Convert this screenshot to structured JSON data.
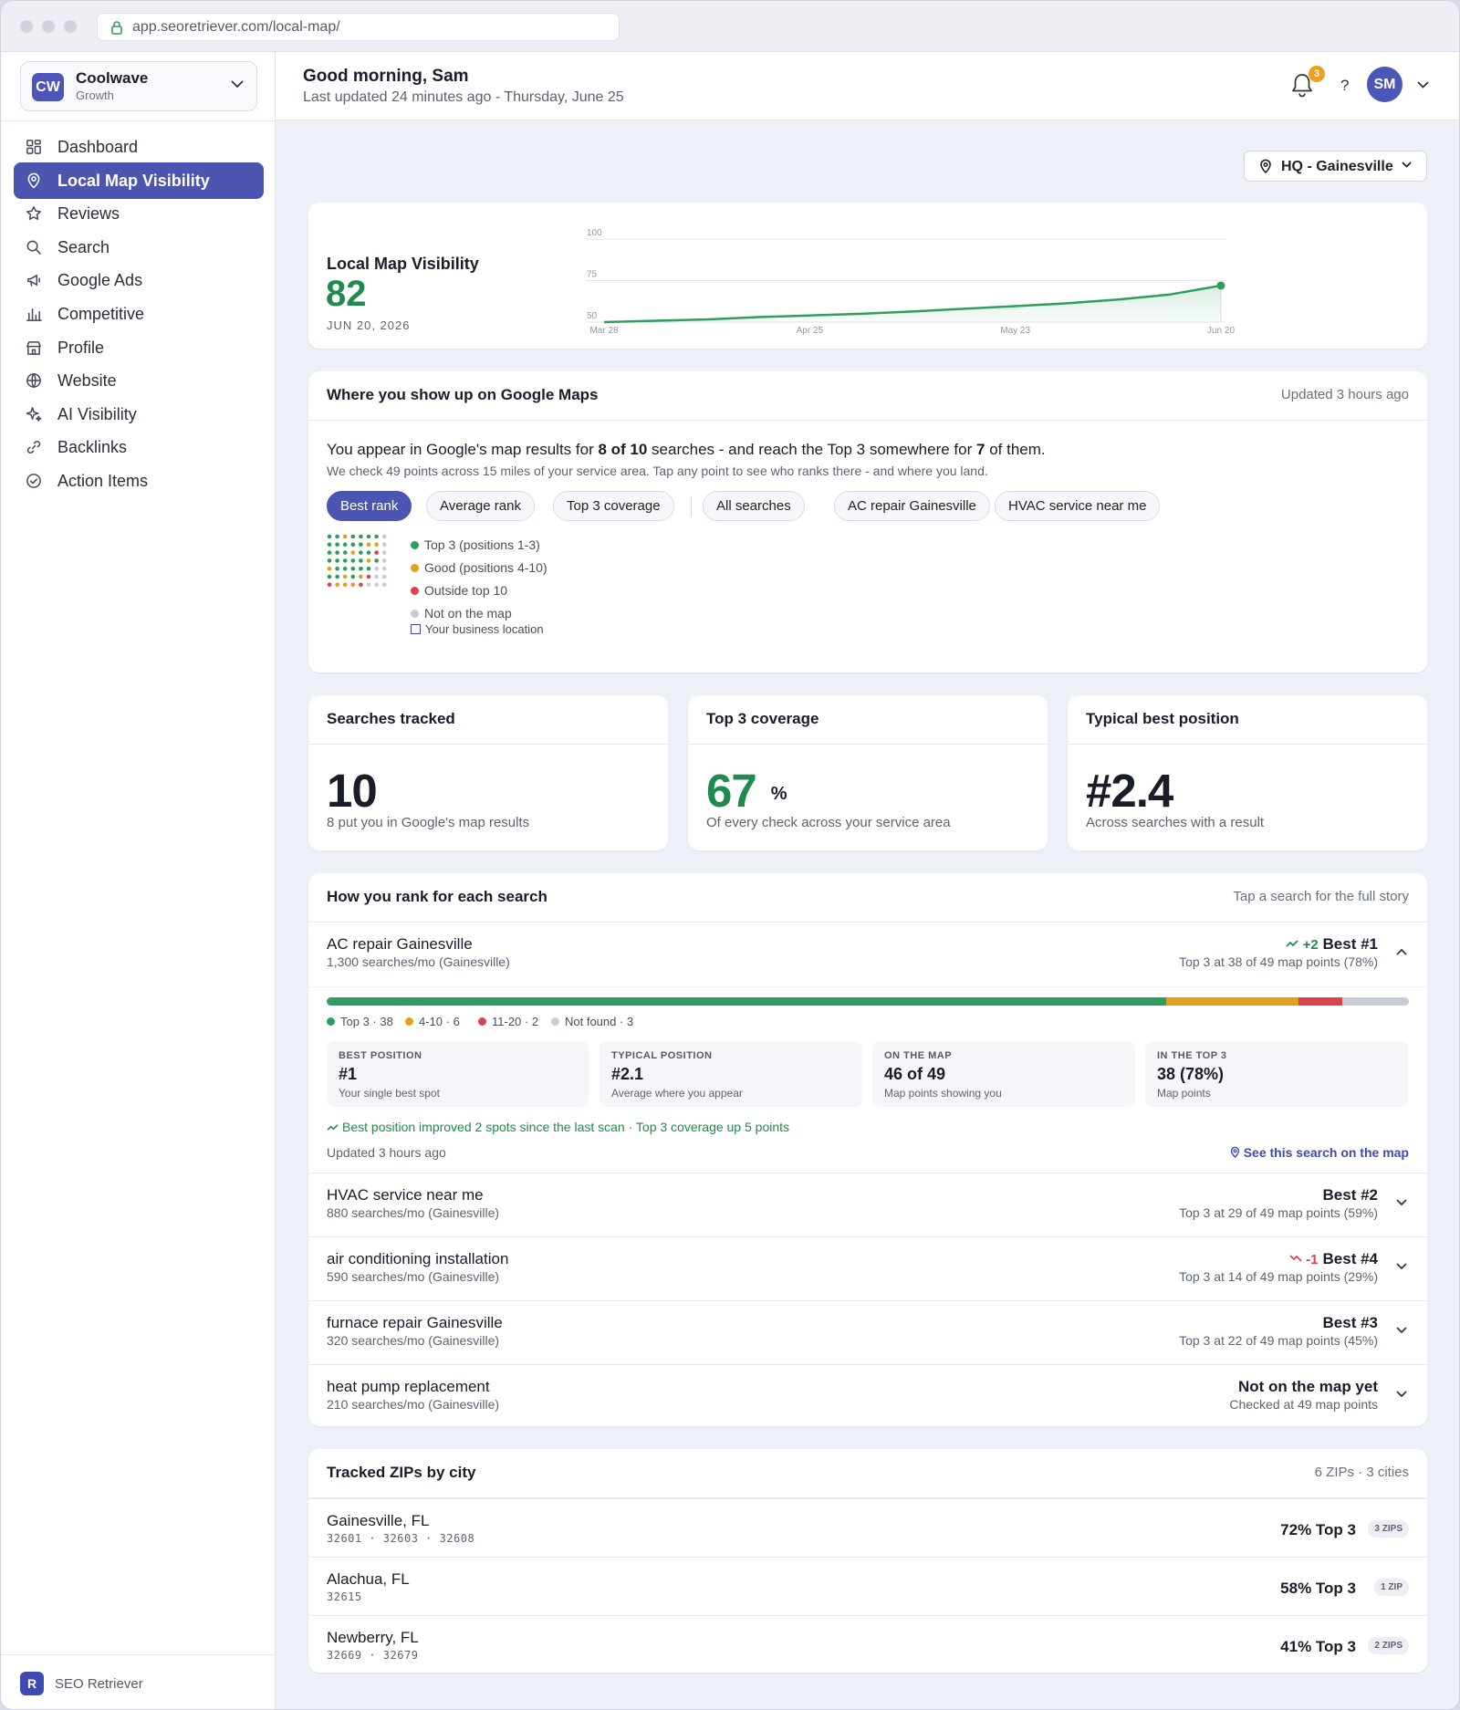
{
  "browser": {
    "url": "app.seoretriever.com/local-map/"
  },
  "account": {
    "initials": "CW",
    "name": "Coolwave",
    "plan": "Growth"
  },
  "nav": [
    {
      "label": "Dashboard",
      "icon": "dashboard-icon"
    },
    {
      "label": "Local Map Visibility",
      "icon": "map-pin-icon",
      "active": true
    },
    {
      "label": "Reviews",
      "icon": "star-icon"
    },
    {
      "label": "Search",
      "icon": "search-icon"
    },
    {
      "label": "Google Ads",
      "icon": "megaphone-icon"
    },
    {
      "label": "Competitive",
      "icon": "bar-chart-icon"
    },
    {
      "label": "Profile",
      "icon": "storefront-icon"
    },
    {
      "label": "Website",
      "icon": "globe-icon"
    },
    {
      "label": "AI Visibility",
      "icon": "sparkle-icon"
    },
    {
      "label": "Backlinks",
      "icon": "link-icon"
    },
    {
      "label": "Action Items",
      "icon": "check-circle-icon"
    }
  ],
  "brand": {
    "initial": "R",
    "name": "SEO Retriever"
  },
  "header": {
    "greeting": "Good morning, Sam",
    "updated": "Last updated 24 minutes ago",
    "date_sep": "-",
    "date": "Thursday, June 25",
    "notifications": "3",
    "help": "?",
    "avatar": "SM"
  },
  "location_select": {
    "label": "HQ - Gainesville"
  },
  "visibility": {
    "title": "Local Map Visibility",
    "score": "82",
    "date": "JUN 20, 2026",
    "accent": "#1e8a4c"
  },
  "chart_data": {
    "type": "area",
    "x": [
      "Mar 28",
      "Apr 4",
      "Apr 11",
      "Apr 18",
      "Apr 25",
      "May 2",
      "May 9",
      "May 16",
      "May 23",
      "May 30",
      "Jun 6",
      "Jun 13",
      "Jun 20"
    ],
    "xticks": [
      "Mar 28",
      "Apr 25",
      "May 23",
      "Jun 20"
    ],
    "series": [
      {
        "values": [
          50,
          50.8,
          51.6,
          53,
          54,
          55,
          56.4,
          58,
          59.6,
          61.3,
          63.6,
          66.6,
          72
        ]
      }
    ],
    "ylim": [
      50,
      100
    ],
    "yticks": [
      "50",
      "75",
      "100"
    ],
    "grid": true,
    "color": "#2e9d5e"
  },
  "maps": {
    "title": "Where you show up on Google Maps",
    "updated": "Updated 3 hours ago",
    "sentence": {
      "p1": "You appear in Google's map results for ",
      "b1": "8 of 10",
      "p2": " searches - and reach the Top 3 somewhere for ",
      "b2": "7",
      "p3": " of them."
    },
    "note": "We check 49 points across 15 miles of your service area. Tap any point to see who ranks there - and where you land.",
    "metric_tabs": [
      "Best rank",
      "Average rank",
      "Top 3 coverage"
    ],
    "search_tabs": [
      "All searches",
      "AC repair Gainesville",
      "HVAC service near me"
    ],
    "legend": [
      "Top 3 (positions 1-3)",
      "Good (positions 4-10)",
      "Outside top 10",
      "Not on the map"
    ],
    "business_location": "Your business location",
    "colors": {
      "top3": "#2e9d5e",
      "good": "#e0a020",
      "outside": "#d9434f",
      "none": "#c9cbd6"
    },
    "grid": [
      [
        "g",
        "g",
        "o",
        "g",
        "g",
        "g",
        "g",
        "n"
      ],
      [
        "g",
        "g",
        "g",
        "g",
        "g",
        "o",
        "o",
        "n"
      ],
      [
        "g",
        "g",
        "g",
        "o",
        "g",
        "g",
        "r",
        "n"
      ],
      [
        "g",
        "g",
        "g",
        "g",
        "g",
        "o",
        "g",
        "n"
      ],
      [
        "o",
        "g",
        "g",
        "g",
        "g",
        "g",
        "n",
        "n"
      ],
      [
        "g",
        "g",
        "o",
        "g",
        "o",
        "r",
        "n",
        "n"
      ],
      [
        "r",
        "o",
        "o",
        "o",
        "r",
        "n",
        "n",
        "n"
      ]
    ]
  },
  "stats": [
    {
      "title": "Searches tracked",
      "value": "10",
      "caption": "8 put you in Google's map results"
    },
    {
      "title": "Top 3 coverage",
      "value": "67",
      "unit": "%",
      "caption": "Of every check across your service area"
    },
    {
      "title": "Typical best position",
      "value": "#2.4",
      "caption": "Across searches with a result"
    }
  ],
  "ranks": {
    "title": "How you rank for each search",
    "hint": "Tap a search for the full story",
    "expanded": {
      "keyword": "AC repair Gainesville",
      "volume": "1,300 searches/mo (Gainesville)",
      "change": "+2",
      "best": "Best #1",
      "summary": "Top 3 at 38 of 49 map points (78%)",
      "bar": [
        {
          "label": "Top 3 · 38",
          "count": 38,
          "color": "#2e9d5e"
        },
        {
          "label": "4-10 · 6",
          "count": 6,
          "color": "#e0a020"
        },
        {
          "label": "11-20 · 2",
          "count": 2,
          "color": "#d9434f"
        },
        {
          "label": "Not found · 3",
          "count": 3,
          "color": "#c9cbd6"
        }
      ],
      "metrics": [
        {
          "label": "BEST POSITION",
          "value": "#1",
          "sub": "Your single best spot"
        },
        {
          "label": "TYPICAL POSITION",
          "value": "#2.1",
          "sub": "Average where you appear"
        },
        {
          "label": "ON THE MAP",
          "value": "46 of 49",
          "sub": "Map points showing you"
        },
        {
          "label": "IN THE TOP 3",
          "value": "38 (78%)",
          "sub": "Map points"
        }
      ],
      "trend": "Best position improved 2 spots since the last scan · Top 3 coverage up 5 points",
      "updated": "Updated 3 hours ago",
      "map_link": "See this search on the map"
    },
    "rows": [
      {
        "keyword": "HVAC service near me",
        "volume": "880 searches/mo (Gainesville)",
        "best": "Best #2",
        "summary": "Top 3 at 29 of 49 map points (59%)",
        "change": ""
      },
      {
        "keyword": "air conditioning installation",
        "volume": "590 searches/mo (Gainesville)",
        "best": "Best #4",
        "summary": "Top 3 at 14 of 49 map points (29%)",
        "change": "-1"
      },
      {
        "keyword": "furnace repair Gainesville",
        "volume": "320 searches/mo (Gainesville)",
        "best": "Best #3",
        "summary": "Top 3 at 22 of 49 map points (45%)",
        "change": ""
      },
      {
        "keyword": "heat pump replacement",
        "volume": "210 searches/mo (Gainesville)",
        "best": "Not on the map yet",
        "summary": "Checked at 49 map points",
        "change": ""
      }
    ]
  },
  "zips": {
    "title": "Tracked ZIPs by city",
    "summary": "6 ZIPs · 3 cities",
    "cities": [
      {
        "city": "Gainesville, FL",
        "zips": "32601 · 32603 · 32608",
        "pct": "72% Top 3",
        "badge": "3 ZIPS"
      },
      {
        "city": "Alachua, FL",
        "zips": "32615",
        "pct": "58% Top 3",
        "badge": "1 ZIP"
      },
      {
        "city": "Newberry, FL",
        "zips": "32669 · 32679",
        "pct": "41% Top 3",
        "badge": "2 ZIPS"
      }
    ]
  }
}
